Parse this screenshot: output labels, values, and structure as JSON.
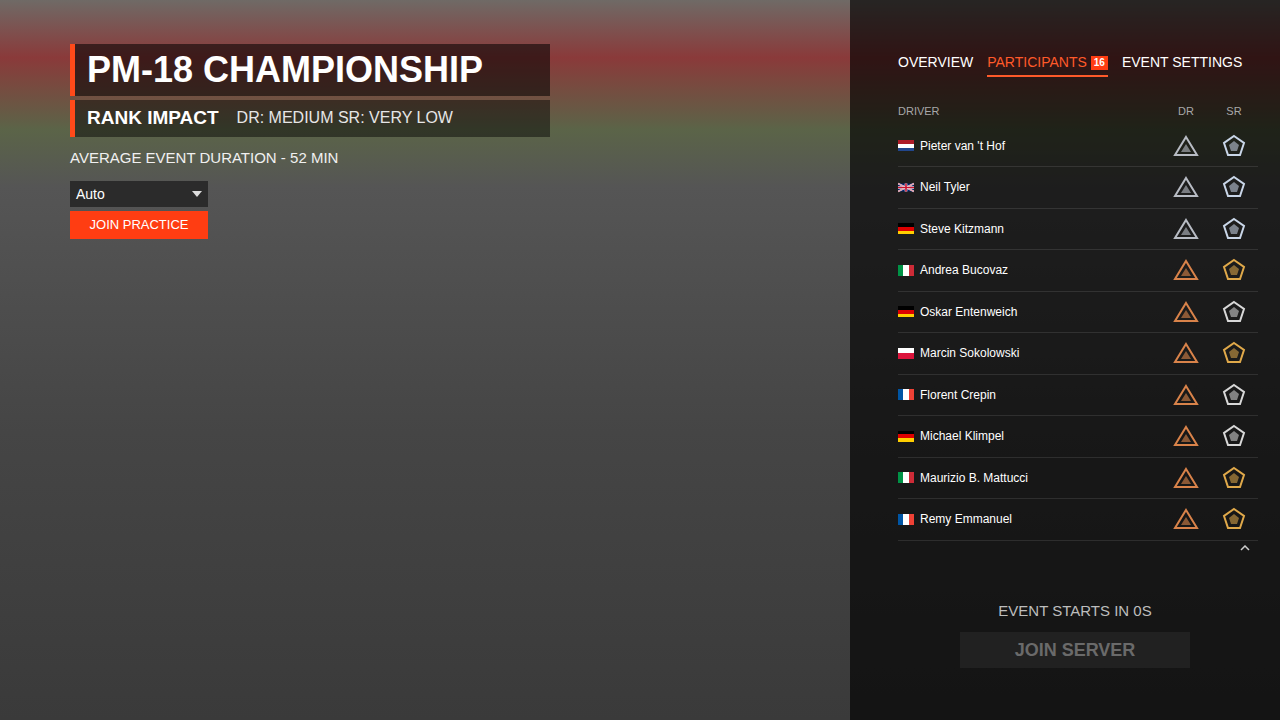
{
  "event": {
    "title": "PM-18 CHAMPIONSHIP",
    "rank_impact_label": "RANK IMPACT",
    "rank_impact_value": "DR: MEDIUM SR: VERY LOW",
    "duration": "AVERAGE EVENT DURATION - 52 MIN",
    "dropdown": {
      "value": "Auto"
    },
    "join_practice": "JOIN PRACTICE"
  },
  "tabs": [
    {
      "label": "OVERVIEW",
      "selected": false,
      "badge": ""
    },
    {
      "label": "PARTICIPANTS",
      "selected": true,
      "badge": "16"
    },
    {
      "label": "EVENT SETTINGS",
      "selected": false,
      "badge": ""
    }
  ],
  "table": {
    "columns": [
      "DRIVER",
      "DR",
      "SR"
    ],
    "rows": [
      {
        "name": "Pieter van 't Hof",
        "flag": "NL",
        "dr_color": "#b8bcc4",
        "sr_color": "#c9d6e8"
      },
      {
        "name": "Neil Tyler",
        "flag": "GB",
        "dr_color": "#b8bcc4",
        "sr_color": "#c9d6e8"
      },
      {
        "name": "Steve Kitzmann",
        "flag": "DE",
        "dr_color": "#b8bcc4",
        "sr_color": "#c9d6e8"
      },
      {
        "name": "Andrea Bucovaz",
        "flag": "IT",
        "dr_color": "#d9834a",
        "sr_color": "#e0a94a"
      },
      {
        "name": "Oskar Entenweich",
        "flag": "DE",
        "dr_color": "#d9834a",
        "sr_color": "#d8d8d8"
      },
      {
        "name": "Marcin Sokolowski",
        "flag": "PL",
        "dr_color": "#d9834a",
        "sr_color": "#e0a94a"
      },
      {
        "name": "Florent Crepin",
        "flag": "FR",
        "dr_color": "#d9834a",
        "sr_color": "#d8d8d8"
      },
      {
        "name": "Michael Klimpel",
        "flag": "DE",
        "dr_color": "#d9834a",
        "sr_color": "#d8d8d8"
      },
      {
        "name": "Maurizio B. Mattucci",
        "flag": "IT",
        "dr_color": "#d9834a",
        "sr_color": "#e0a94a"
      },
      {
        "name": "Remy Emmanuel",
        "flag": "FR",
        "dr_color": "#d9834a",
        "sr_color": "#e0a94a"
      }
    ]
  },
  "footer": {
    "countdown": "EVENT STARTS IN 0S",
    "join_server": "JOIN SERVER",
    "join_server_disabled": true
  }
}
